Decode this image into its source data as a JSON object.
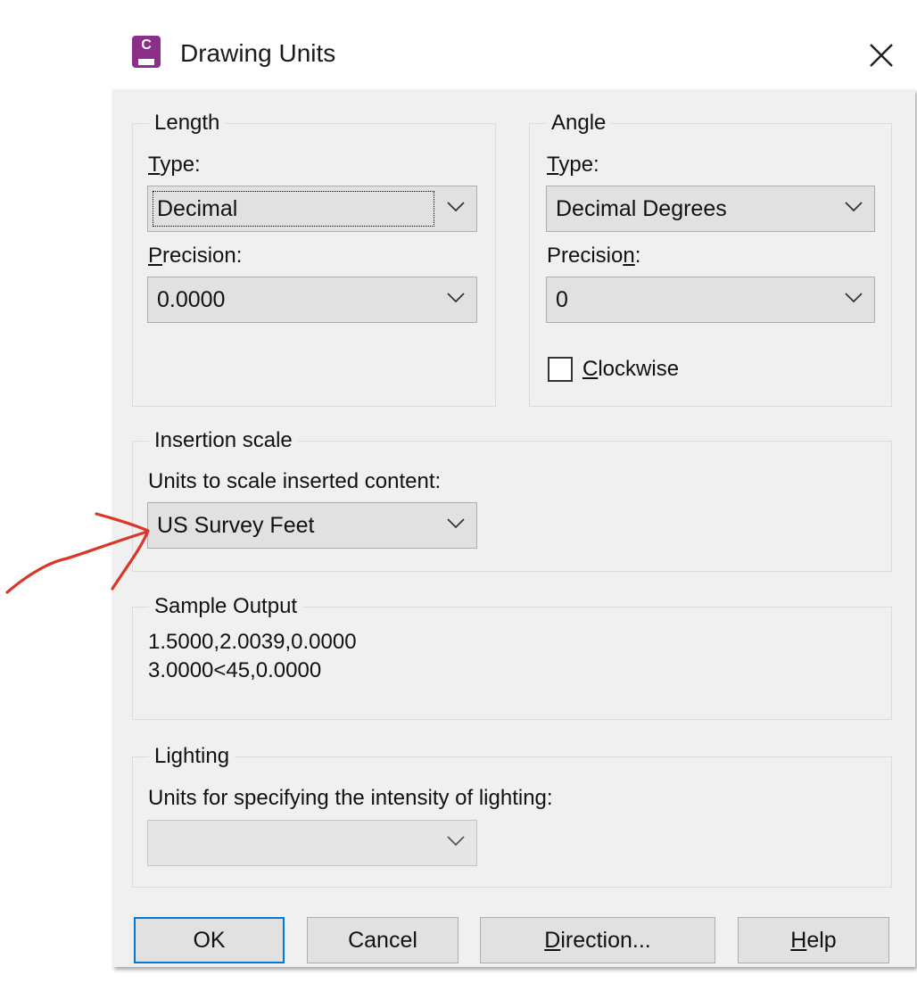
{
  "window": {
    "title": "Drawing Units",
    "icon_letter": "C",
    "close_glyph": "✕"
  },
  "length": {
    "legend": "Length",
    "type_label_u": "T",
    "type_label_rest": "ype:",
    "type_value": "Decimal",
    "precision_label_u": "P",
    "precision_label_rest": "recision:",
    "precision_value": "0.0000"
  },
  "angle": {
    "legend": "Angle",
    "type_label_u": "T",
    "type_label_rest": "ype:",
    "type_value": "Decimal Degrees",
    "precision_label_pre": "Precisio",
    "precision_label_u": "n",
    "precision_label_post": ":",
    "precision_value": "0",
    "clockwise_u": "C",
    "clockwise_rest": "lockwise",
    "clockwise_checked": false
  },
  "insertion": {
    "legend": "Insertion scale",
    "label": "Units to scale inserted content:",
    "value": "US Survey Feet"
  },
  "sample": {
    "legend": "Sample Output",
    "line1": "1.5000,2.0039,0.0000",
    "line2": "3.0000<45,0.0000"
  },
  "lighting": {
    "legend": "Lighting",
    "label": "Units for specifying the intensity of lighting:",
    "value": ""
  },
  "buttons": {
    "ok": "OK",
    "cancel": "Cancel",
    "direction_u": "D",
    "direction_rest": "irection...",
    "help_u": "H",
    "help_rest": "elp"
  },
  "annotation": {
    "color": "#d9372a"
  },
  "colors": {
    "accent": "#0078d7",
    "app_icon": "#8b2f88"
  }
}
